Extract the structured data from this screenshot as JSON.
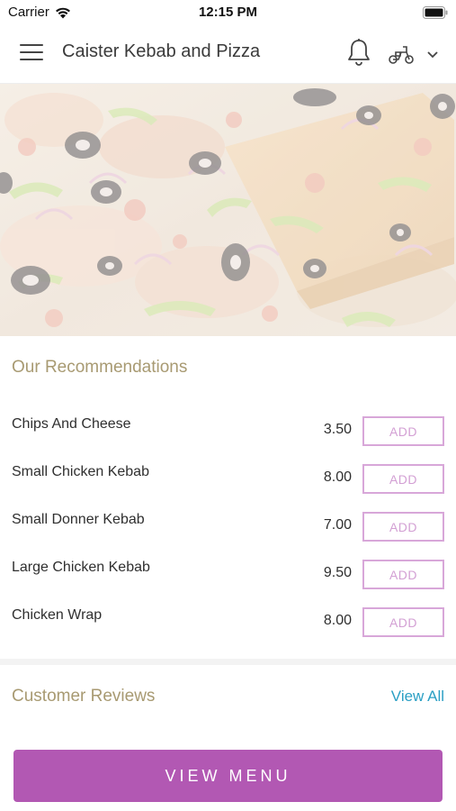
{
  "status_bar": {
    "carrier": "Carrier",
    "time": "12:15 PM"
  },
  "header": {
    "title": "Caister Kebab and Pizza",
    "icons": [
      "menu-icon",
      "bell-icon",
      "scooter-icon",
      "chevron-down-icon"
    ]
  },
  "hero": {
    "image": "pizza-photo"
  },
  "recommendations": {
    "title": "Our Recommendations",
    "items": [
      {
        "name": "Chips And Cheese",
        "price": "3.50",
        "action": "ADD"
      },
      {
        "name": "Small Chicken Kebab",
        "price": "8.00",
        "action": "ADD"
      },
      {
        "name": "Small Donner Kebab",
        "price": "7.00",
        "action": "ADD"
      },
      {
        "name": "Large Chicken Kebab",
        "price": "9.50",
        "action": "ADD"
      },
      {
        "name": "Chicken Wrap",
        "price": "8.00",
        "action": "ADD"
      }
    ]
  },
  "reviews": {
    "title": "Customer Reviews",
    "view_all": "View All"
  },
  "footer": {
    "view_menu": "VIEW MENU"
  },
  "colors": {
    "accent": "#b258b3",
    "section_title": "#a89a72",
    "link": "#2a9fc4",
    "add_border": "#d8a7d9"
  }
}
